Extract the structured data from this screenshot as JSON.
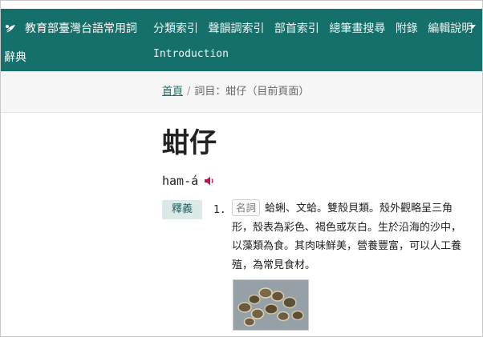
{
  "header": {
    "site_title_line1": "教育部臺灣台語常用詞",
    "site_title_line2": "辭典",
    "nav": [
      "分類索引",
      "聲韻調索引",
      "部首索引",
      "總筆畫搜尋",
      "附錄",
      "編輯說明"
    ],
    "intro_link": "Introduction"
  },
  "breadcrumb": {
    "home": "首頁",
    "separator": "/",
    "current": "詞目：蚶仔（目前頁面）"
  },
  "entry": {
    "headword": "蚶仔",
    "romanization": "ham-á",
    "sense_label": "釋義",
    "senses": [
      {
        "number": "1.",
        "pos": "名詞",
        "definition": "蛤蜊、文蛤。雙殼貝類。殼外觀略呈三角形，殼表為彩色、褐色或灰白。生於沿海的沙中，以藻類為食。其肉味鮮美，營養豐富，可以人工養殖，為常見食材。"
      }
    ]
  },
  "colors": {
    "header_bg": "#156f6a",
    "link": "#156f6a",
    "label_bg": "#dbe9e8",
    "speaker": "#c0134d"
  },
  "icons": {
    "logo": "leaf-logo-icon",
    "audio": "speaker-icon",
    "menu": "caret-down-icon"
  }
}
